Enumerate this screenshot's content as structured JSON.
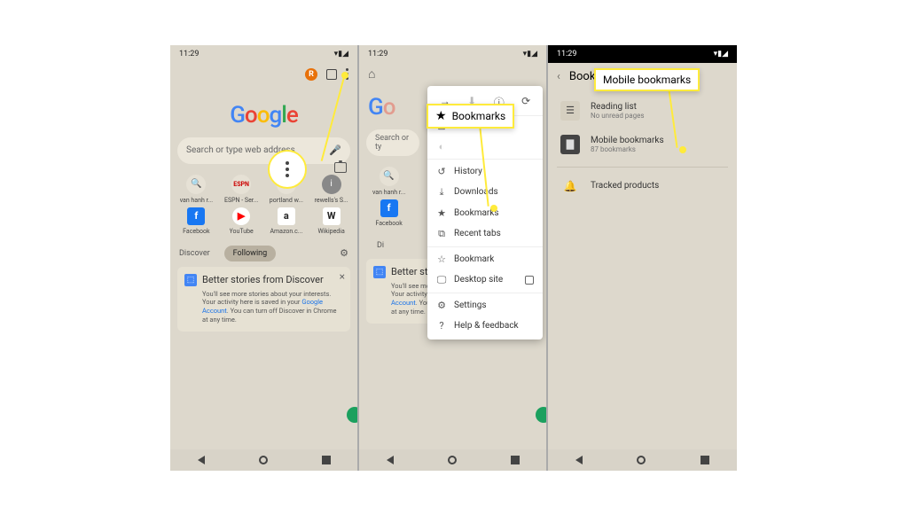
{
  "status": {
    "time": "11:29"
  },
  "screen1": {
    "search_placeholder": "Search or type web address",
    "avatar_letter": "R",
    "shortcuts_row1": [
      {
        "label": "van hanh r..."
      },
      {
        "label": "ESPN - Ser..."
      },
      {
        "label": "portland w..."
      },
      {
        "label": "rewells's S..."
      }
    ],
    "shortcuts_row2": [
      {
        "label": "Facebook"
      },
      {
        "label": "YouTube"
      },
      {
        "label": "Amazon.c..."
      },
      {
        "label": "Wikipedia"
      }
    ],
    "tab_discover": "Discover",
    "tab_following": "Following",
    "card": {
      "title": "Better stories from Discover",
      "body_pre": "You'll see more stories about your interests. Your activity here is saved in your ",
      "body_link": "Google Account",
      "body_post": ". You can turn off Discover in Chrome at any time."
    }
  },
  "screen2": {
    "callout": "Bookmarks",
    "menu": {
      "history": "History",
      "downloads": "Downloads",
      "bookmarks": "Bookmarks",
      "recent_tabs": "Recent tabs",
      "bookmark": "Bookmark",
      "desktop": "Desktop site",
      "settings": "Settings",
      "help": "Help & feedback"
    }
  },
  "screen3": {
    "header": "Bookma",
    "callout": "Mobile bookmarks",
    "items": [
      {
        "title": "Reading list",
        "sub": "No unread pages"
      },
      {
        "title": "Mobile bookmarks",
        "sub": "87 bookmarks"
      }
    ],
    "tracked": "Tracked products"
  }
}
